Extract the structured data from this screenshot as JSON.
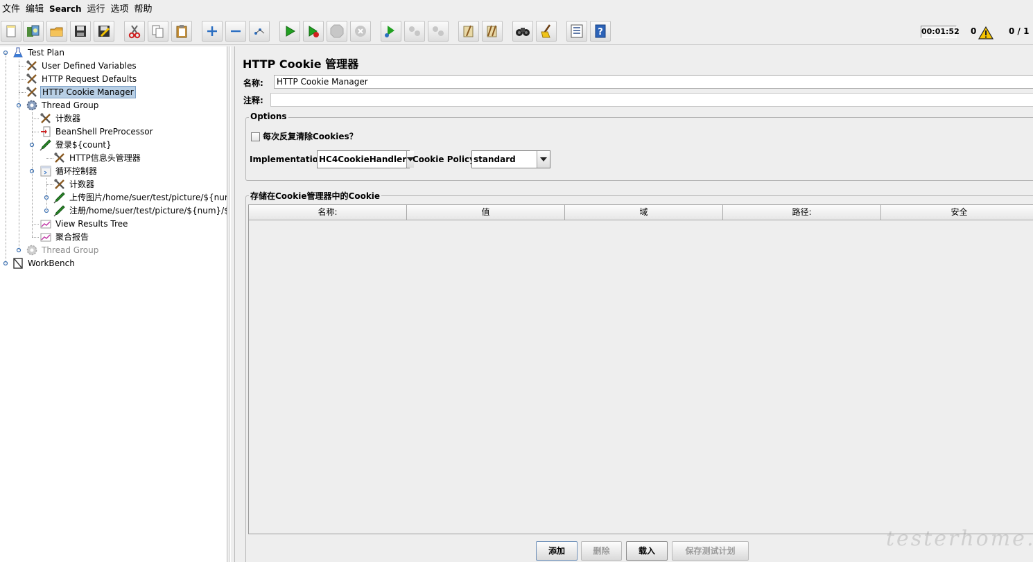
{
  "menu": [
    "文件",
    "编辑",
    "Search",
    "运行",
    "选项",
    "帮助"
  ],
  "toolbar": {
    "buttons": [
      "new-icon",
      "templates-icon",
      "open-icon",
      "save-icon",
      "save-as-icon",
      "cut-icon",
      "copy-icon",
      "paste-icon",
      "expand-icon",
      "collapse-icon",
      "toggle-icon",
      "start-icon",
      "start-no-pause-icon",
      "stop-icon",
      "shutdown-icon",
      "remote-start-icon",
      "remote-stop-icon",
      "remote-exit-icon",
      "clear-icon",
      "clear-all-icon",
      "search-icon",
      "reset-search-icon",
      "function-helper-icon",
      "help-icon"
    ],
    "elapsed": "00:01:52",
    "error_count": "0",
    "threads": "0 / 1"
  },
  "tree": [
    {
      "label": "Test Plan",
      "icon": "test-plan-icon"
    },
    {
      "label": "User Defined Variables",
      "icon": "config-wrench-icon"
    },
    {
      "label": "HTTP Request Defaults",
      "icon": "config-wrench-icon"
    },
    {
      "label": "HTTP Cookie Manager",
      "icon": "config-wrench-icon",
      "selected": true
    },
    {
      "label": "Thread Group",
      "icon": "gear-icon"
    },
    {
      "label": "计数器",
      "icon": "config-wrench-icon"
    },
    {
      "label": "BeanShell PreProcessor",
      "icon": "preprocessor-icon"
    },
    {
      "label": "登录${count}",
      "icon": "sampler-pipette-icon"
    },
    {
      "label": "HTTP信息头管理器",
      "icon": "config-wrench-icon"
    },
    {
      "label": "循环控制器",
      "icon": "controller-icon"
    },
    {
      "label": "计数器",
      "icon": "config-wrench-icon"
    },
    {
      "label": "上传图片/home/suer/test/picture/${num}/${",
      "icon": "sampler-pipette-icon"
    },
    {
      "label": "注册/home/suer/test/picture/${num}/${pic}",
      "icon": "sampler-pipette-icon"
    },
    {
      "label": "View Results Tree",
      "icon": "listener-graph-icon"
    },
    {
      "label": "聚合报告",
      "icon": "listener-graph-icon"
    },
    {
      "label": "Thread Group",
      "icon": "gear-icon",
      "disabled": true
    },
    {
      "label": "WorkBench",
      "icon": "workbench-icon"
    }
  ],
  "panel": {
    "title": "HTTP Cookie 管理器",
    "name_label": "名称:",
    "name_value": "HTTP Cookie Manager",
    "comment_label": "注释:",
    "comment_value": "",
    "options_legend": "Options",
    "clear_each_iteration_label": "每次反复清除Cookies？",
    "clear_each_iteration_checked": false,
    "implementation_label": "Implementation:",
    "implementation_value": "HC4CookieHandler",
    "policy_label": "Cookie Policy:",
    "policy_value": "standard",
    "stored_legend": "存储在Cookie管理器中的Cookie",
    "columns": [
      "名称:",
      "值",
      "域",
      "路径:",
      "安全"
    ],
    "buttons": {
      "add": "添加",
      "delete": "删除",
      "load": "载入",
      "save": "保存测试计划"
    }
  },
  "watermark": "testerhome.com",
  "colors": {
    "selection": "#b8cfe5",
    "background": "#eeeeee",
    "warning": "#f5c400"
  }
}
